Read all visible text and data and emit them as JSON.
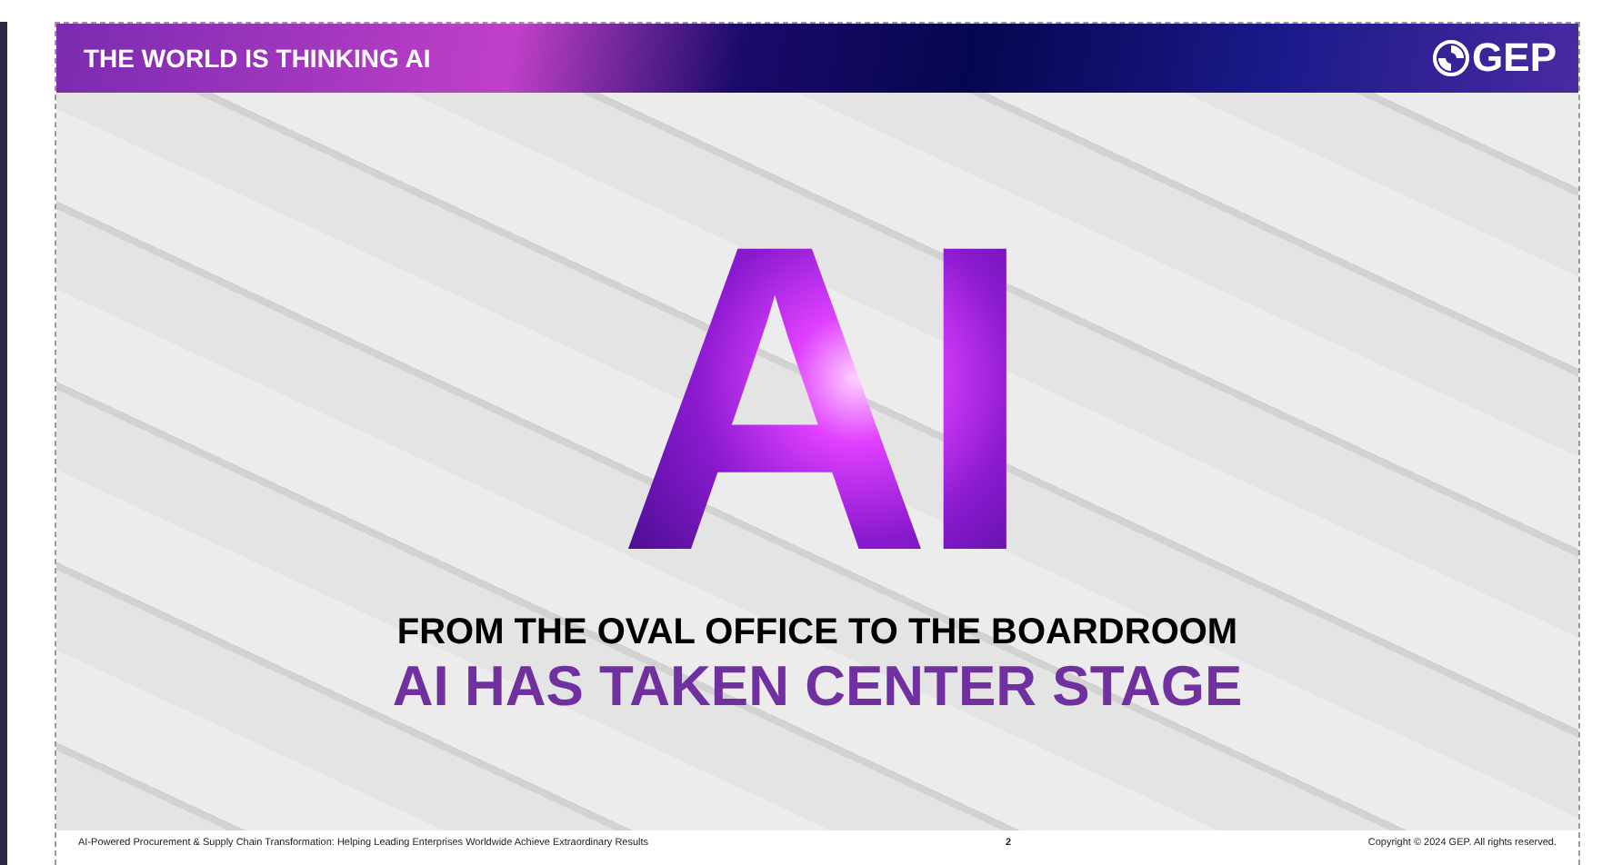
{
  "header": {
    "title": "THE WORLD IS THINKING AI",
    "logo": "GEP"
  },
  "hero": {
    "big_text": "AI",
    "subtitle": "FROM THE OVAL OFFICE TO THE BOARDROOM",
    "headline": "AI HAS TAKEN CENTER STAGE"
  },
  "footer": {
    "left": "AI-Powered Procurement & Supply Chain Transformation: Helping Leading Enterprises Worldwide Achieve Extraordinary Results",
    "page": "2",
    "right": "Copyright © 2024 GEP. All rights reserved."
  }
}
